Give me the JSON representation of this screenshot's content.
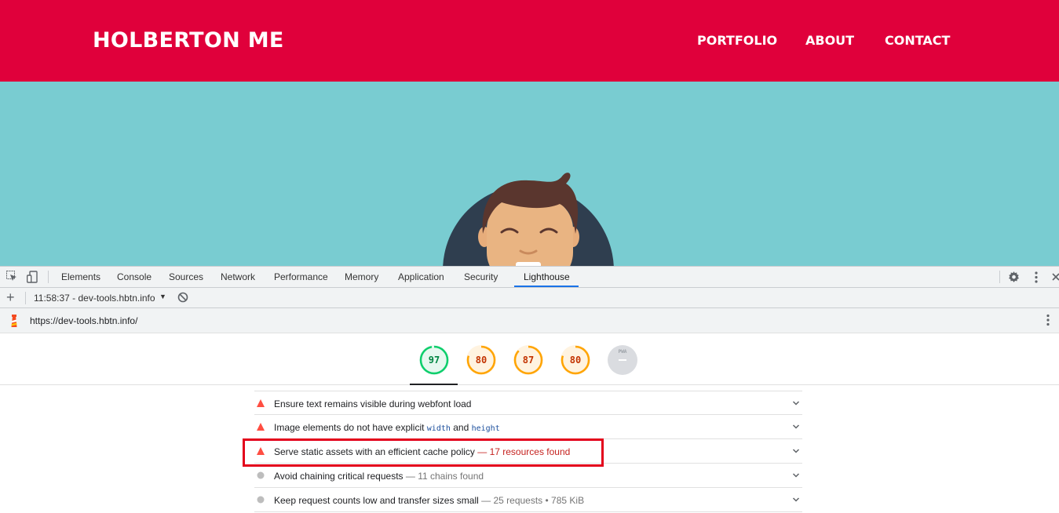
{
  "site": {
    "logo": "HOLBERTON ME",
    "nav": [
      "PORTFOLIO",
      "ABOUT",
      "CONTACT"
    ],
    "colors": {
      "header": "#e0003b",
      "hero": "#79ccd1"
    }
  },
  "devtools": {
    "tabs": [
      "Elements",
      "Console",
      "Sources",
      "Network",
      "Performance",
      "Memory",
      "Application",
      "Security",
      "Lighthouse"
    ],
    "active_tab": "Lighthouse",
    "run": {
      "label": "11:58:37 - dev-tools.hbtn.info"
    },
    "url": "https://dev-tools.hbtn.info/",
    "gauges": [
      {
        "score": "97",
        "color": "#0cce6b",
        "level": 0.97
      },
      {
        "score": "80",
        "color": "#ffa400",
        "level": 0.8
      },
      {
        "score": "87",
        "color": "#ffa400",
        "level": 0.87
      },
      {
        "score": "80",
        "color": "#ffa400",
        "level": 0.8
      },
      {
        "score": "PWA",
        "color": "#dadce0",
        "level": 0
      }
    ],
    "audits": [
      {
        "status": "fail",
        "title": "Ensure text remains visible during webfont load",
        "extra": ""
      },
      {
        "status": "fail",
        "title_pre": "Image elements do not have explicit ",
        "code1": "width",
        "mid": " and ",
        "code2": "height",
        "extra": ""
      },
      {
        "status": "fail",
        "title": "Serve static assets with an efficient cache policy",
        "extra": " — 17 resources found",
        "highlighted": true
      },
      {
        "status": "info",
        "title": "Avoid chaining critical requests",
        "extra": " — 11 chains found"
      },
      {
        "status": "info",
        "title": "Keep request counts low and transfer sizes small",
        "extra": " — 25 requests • 785 KiB"
      }
    ]
  }
}
